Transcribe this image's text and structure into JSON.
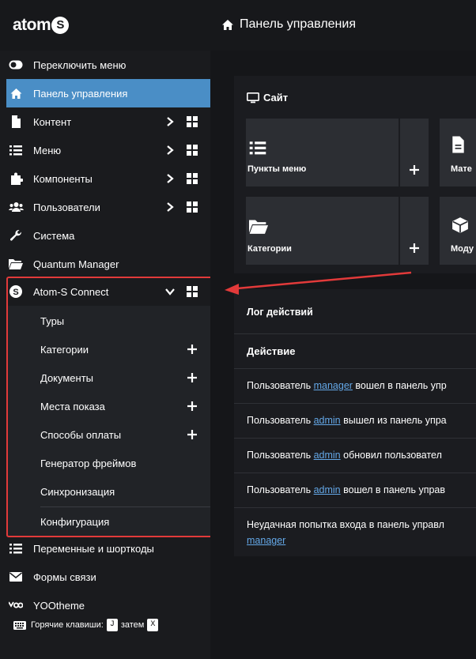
{
  "header": {
    "logo_text": "atom",
    "logo_badge": "S",
    "page_title": "Панель управления"
  },
  "sidebar": {
    "items": [
      {
        "label": "Переключить меню",
        "icon": "toggle-icon"
      },
      {
        "label": "Панель управления",
        "icon": "home-icon",
        "active": true
      },
      {
        "label": "Контент",
        "icon": "file-icon"
      },
      {
        "label": "Меню",
        "icon": "list-icon"
      },
      {
        "label": "Компоненты",
        "icon": "puzzle-icon"
      },
      {
        "label": "Пользователи",
        "icon": "users-icon"
      },
      {
        "label": "Система",
        "icon": "wrench-icon"
      },
      {
        "label": "Quantum Manager",
        "icon": "folder-icon"
      },
      {
        "label": "Atom-S Connect",
        "icon": "atom-s-icon"
      }
    ],
    "submenu": [
      {
        "label": "Туры"
      },
      {
        "label": "Категории"
      },
      {
        "label": "Документы"
      },
      {
        "label": "Места показа"
      },
      {
        "label": "Способы оплаты"
      },
      {
        "label": "Генератор фреймов"
      },
      {
        "label": "Синхронизация"
      },
      {
        "label": "Конфигурация"
      }
    ],
    "bottom_items": [
      {
        "label": "Переменные и шорткоды",
        "icon": "list-icon"
      },
      {
        "label": "Формы связи",
        "icon": "envelope-icon"
      },
      {
        "label": "YOOtheme",
        "icon": "yootheme-icon"
      }
    ],
    "footer": {
      "label": "Горячие клавиши:",
      "key1": "J",
      "then": "затем",
      "key2": "X"
    }
  },
  "site_card": {
    "title": "Сайт",
    "tiles": [
      {
        "label": "Пункты меню"
      },
      {
        "label": "Мате"
      },
      {
        "label": "Категории"
      },
      {
        "label": "Моду"
      }
    ],
    "add_symbol": "+"
  },
  "action_log": {
    "title": "Лог действий",
    "column_header": "Действие",
    "rows": [
      {
        "pre": "Пользователь ",
        "link": "manager",
        "post": " вошел в панель упр"
      },
      {
        "pre": "Пользователь ",
        "link": "admin",
        "post": " вышел из панель упра"
      },
      {
        "pre": "Пользователь ",
        "link": "admin",
        "post": " обновил пользовател"
      },
      {
        "pre": "Пользователь ",
        "link": "admin",
        "post": " вошел в панель управ"
      },
      {
        "pre": "Неудачная попытка входа в панель управл",
        "link": "manager",
        "post": ""
      }
    ]
  },
  "colors": {
    "active_item": "#4a8ec6",
    "highlight": "#e23a3a",
    "link": "#64a8e8"
  }
}
